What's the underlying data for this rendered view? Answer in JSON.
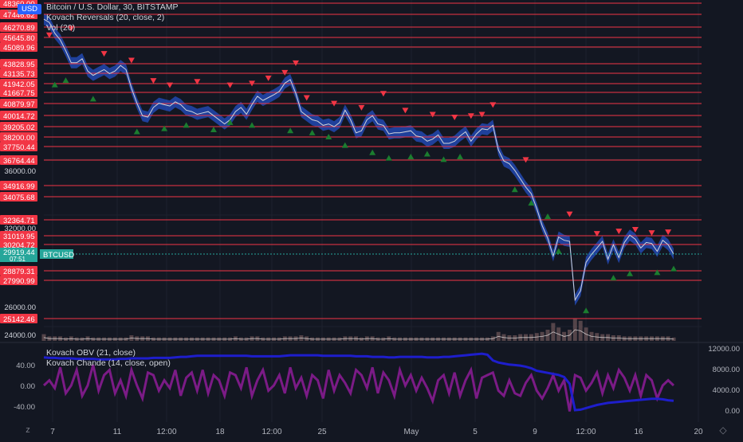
{
  "legend": {
    "symbol": "Bitcoin / U.S. Dollar, 30, BITSTAMP",
    "ind1": "Kovach Reversals (20, close, 2)",
    "ind2": "Vol (20)",
    "osc1": "Kovach OBV (21, close)",
    "osc2": "Kovach Chande (14, close, open)"
  },
  "currency_badge": "USD",
  "icons": {
    "top_left": "chevron-down-icon",
    "bottom_left": "z-zoom-icon",
    "bottom_right": "diamond-icon"
  },
  "colors": {
    "background": "#131722",
    "level_line": "#f23645",
    "level_label_bg": "#f23645",
    "price_line": "#d1d4dc",
    "band": "#2962ff",
    "sell_marker": "#f23645",
    "buy_marker": "#1b7d2f",
    "current_price": "#26a69a",
    "obv": "#1e1ecc",
    "chande": "#7b1b86"
  },
  "chart_data": {
    "type": "line",
    "title": "Bitcoin / U.S. Dollar, 30, BITSTAMP",
    "price_axis": {
      "ticks": [
        {
          "value": 36000,
          "label": "36000.00"
        },
        {
          "value": 32000,
          "label": "32000.00"
        },
        {
          "value": 26000,
          "label": "26000.00"
        },
        {
          "value": 24000,
          "label": "24000.00"
        }
      ]
    },
    "levels": [
      {
        "value": 48360.0,
        "label": "48360.00"
      },
      {
        "value": 47446.62,
        "label": "47446.62"
      },
      {
        "value": 46270.89,
        "label": "46270.89"
      },
      {
        "value": 45645.8,
        "label": "45645.80"
      },
      {
        "value": 45089.96,
        "label": "45089.96"
      },
      {
        "value": 43828.95,
        "label": "43828.95"
      },
      {
        "value": 43135.73,
        "label": "43135.73"
      },
      {
        "value": 41942.05,
        "label": "41942.05"
      },
      {
        "value": 41667.75,
        "label": "41667.75"
      },
      {
        "value": 40879.97,
        "label": "40879.97"
      },
      {
        "value": 40014.72,
        "label": "40014.72"
      },
      {
        "value": 39205.02,
        "label": "39205.02"
      },
      {
        "value": 38200.0,
        "label": "38200.00"
      },
      {
        "value": 37750.44,
        "label": "37750.44"
      },
      {
        "value": 36764.44,
        "label": "36764.44"
      },
      {
        "value": 34916.99,
        "label": "34916.99"
      },
      {
        "value": 34075.68,
        "label": "34075.68"
      },
      {
        "value": 32364.71,
        "label": "32364.71"
      },
      {
        "value": 31019.95,
        "label": "31019.95"
      },
      {
        "value": 30204.72,
        "label": "30204.72"
      },
      {
        "value": 28879.31,
        "label": "28879.31"
      },
      {
        "value": 27990.99,
        "label": "27990.99"
      },
      {
        "value": 25142.46,
        "label": "25142.46"
      }
    ],
    "current_price": {
      "value": 29919.44,
      "label": "29919.44",
      "countdown": "07:51",
      "symbol_tag": "BTCUSD"
    },
    "x_ticks": [
      "7",
      "11",
      "12:00",
      "18",
      "12:00",
      "25",
      "May",
      "5",
      "9",
      "12:00",
      "16",
      "20"
    ],
    "price_series": {
      "name": "BTCUSD close",
      "values": [
        47000,
        46700,
        45900,
        45500,
        44800,
        43900,
        43900,
        44200,
        43300,
        42900,
        43200,
        43400,
        43100,
        43300,
        43700,
        43400,
        41800,
        40900,
        40000,
        39900,
        40600,
        40900,
        40800,
        40700,
        41000,
        40800,
        40400,
        40300,
        40100,
        40200,
        40300,
        40000,
        39700,
        39400,
        39700,
        40300,
        40600,
        40100,
        40800,
        41400,
        41100,
        41300,
        41500,
        41700,
        42000,
        42400,
        41600,
        40300,
        40000,
        39700,
        39600,
        39300,
        39400,
        39200,
        39500,
        40400,
        39700,
        38600,
        38800,
        39700,
        40000,
        39400,
        39300,
        38500,
        38600,
        38600,
        38700,
        38800,
        38300,
        38200,
        38000,
        38100,
        38400,
        37900,
        37900,
        38000,
        38300,
        38700,
        38000,
        38500,
        39000,
        38900,
        39300,
        37500,
        36700,
        36500,
        36000,
        35400,
        34800,
        34300,
        33200,
        32100,
        30800,
        29800,
        30900,
        30600,
        30500,
        26500,
        27200,
        29400,
        29900,
        30100,
        30500,
        29600,
        30200,
        29700,
        30400,
        31100,
        30700,
        30100,
        30400,
        30300,
        30000,
        30600,
        30200,
        29919
      ]
    },
    "sell_signals": [
      {
        "i": 1,
        "y": 45800
      },
      {
        "i": 5,
        "y": 46200
      },
      {
        "i": 11,
        "y": 44600
      },
      {
        "i": 16,
        "y": 44100
      },
      {
        "i": 20,
        "y": 42300
      },
      {
        "i": 23,
        "y": 41900
      },
      {
        "i": 28,
        "y": 42200
      },
      {
        "i": 34,
        "y": 41900
      },
      {
        "i": 38,
        "y": 42000
      },
      {
        "i": 41,
        "y": 42600
      },
      {
        "i": 44,
        "y": 43200
      },
      {
        "i": 46,
        "y": 43900
      },
      {
        "i": 48,
        "y": 41300
      },
      {
        "i": 53,
        "y": 40900
      },
      {
        "i": 58,
        "y": 40600
      },
      {
        "i": 62,
        "y": 41600
      },
      {
        "i": 66,
        "y": 40400
      },
      {
        "i": 71,
        "y": 40100
      },
      {
        "i": 75,
        "y": 39900
      },
      {
        "i": 78,
        "y": 40000
      },
      {
        "i": 80,
        "y": 40100
      },
      {
        "i": 82,
        "y": 40800
      },
      {
        "i": 88,
        "y": 36800
      },
      {
        "i": 96,
        "y": 32800
      },
      {
        "i": 101,
        "y": 31300
      },
      {
        "i": 105,
        "y": 31600
      },
      {
        "i": 108,
        "y": 31800
      },
      {
        "i": 111,
        "y": 31400
      },
      {
        "i": 114,
        "y": 31500
      }
    ],
    "buy_signals": [
      {
        "i": 2,
        "y": 41900
      },
      {
        "i": 4,
        "y": 42300
      },
      {
        "i": 9,
        "y": 41200
      },
      {
        "i": 17,
        "y": 38700
      },
      {
        "i": 22,
        "y": 39000
      },
      {
        "i": 26,
        "y": 39300
      },
      {
        "i": 31,
        "y": 38900
      },
      {
        "i": 34,
        "y": 39500
      },
      {
        "i": 38,
        "y": 39300
      },
      {
        "i": 45,
        "y": 38800
      },
      {
        "i": 49,
        "y": 38600
      },
      {
        "i": 52,
        "y": 38200
      },
      {
        "i": 55,
        "y": 37800
      },
      {
        "i": 60,
        "y": 37300
      },
      {
        "i": 63,
        "y": 36900
      },
      {
        "i": 67,
        "y": 37000
      },
      {
        "i": 70,
        "y": 37200
      },
      {
        "i": 73,
        "y": 36800
      },
      {
        "i": 76,
        "y": 37000
      },
      {
        "i": 86,
        "y": 34600
      },
      {
        "i": 89,
        "y": 33600
      },
      {
        "i": 92,
        "y": 32600
      },
      {
        "i": 94,
        "y": 30000
      },
      {
        "i": 99,
        "y": 25700
      },
      {
        "i": 104,
        "y": 28200
      },
      {
        "i": 107,
        "y": 28600
      },
      {
        "i": 112,
        "y": 28700
      },
      {
        "i": 115,
        "y": 29000
      }
    ],
    "volume": {
      "name": "Vol",
      "values": [
        0.3,
        0.2,
        0.2,
        0.2,
        0.15,
        0.2,
        0.15,
        0.15,
        0.2,
        0.15,
        0.15,
        0.15,
        0.15,
        0.15,
        0.15,
        0.15,
        0.25,
        0.2,
        0.2,
        0.2,
        0.15,
        0.15,
        0.15,
        0.15,
        0.15,
        0.15,
        0.15,
        0.15,
        0.15,
        0.15,
        0.15,
        0.15,
        0.15,
        0.15,
        0.15,
        0.2,
        0.15,
        0.15,
        0.2,
        0.2,
        0.15,
        0.15,
        0.15,
        0.15,
        0.2,
        0.2,
        0.2,
        0.25,
        0.2,
        0.15,
        0.15,
        0.15,
        0.15,
        0.15,
        0.15,
        0.2,
        0.2,
        0.2,
        0.15,
        0.2,
        0.2,
        0.15,
        0.15,
        0.2,
        0.15,
        0.15,
        0.15,
        0.15,
        0.15,
        0.15,
        0.15,
        0.15,
        0.15,
        0.15,
        0.15,
        0.15,
        0.15,
        0.15,
        0.15,
        0.15,
        0.15,
        0.15,
        0.2,
        0.4,
        0.3,
        0.25,
        0.25,
        0.3,
        0.3,
        0.3,
        0.35,
        0.4,
        0.5,
        0.8,
        0.6,
        0.4,
        0.5,
        1.0,
        0.9,
        0.6,
        0.4,
        0.35,
        0.3,
        0.3,
        0.25,
        0.25,
        0.2,
        0.2,
        0.2,
        0.2,
        0.2,
        0.2,
        0.2,
        0.2,
        0.2,
        0.15
      ]
    },
    "obv": {
      "axis_ticks": [
        {
          "value": 12000,
          "label": "12000.00"
        },
        {
          "value": 8000,
          "label": "8000.00"
        },
        {
          "value": 4000,
          "label": "4000.00"
        },
        {
          "value": 0,
          "label": "0.00"
        }
      ],
      "values": [
        10200,
        10100,
        10100,
        10000,
        10000,
        10000,
        9900,
        9900,
        9900,
        9900,
        9800,
        9800,
        9800,
        9800,
        9900,
        9900,
        10000,
        10000,
        10000,
        10000,
        10100,
        10100,
        10100,
        10100,
        10200,
        10300,
        10300,
        10400,
        10500,
        10500,
        10500,
        10500,
        10500,
        10500,
        10500,
        10500,
        10500,
        10500,
        10400,
        10400,
        10400,
        10400,
        10400,
        10400,
        10500,
        10600,
        10600,
        10600,
        10600,
        10600,
        10600,
        10500,
        10500,
        10500,
        10500,
        10500,
        10500,
        10400,
        10400,
        10400,
        10300,
        10300,
        10300,
        10200,
        10200,
        10300,
        10300,
        10300,
        10300,
        10300,
        10200,
        10200,
        10200,
        10300,
        10300,
        10400,
        10500,
        10600,
        10700,
        10800,
        10900,
        10700,
        9600,
        9200,
        9000,
        8800,
        8700,
        8600,
        8400,
        8100,
        7600,
        7400,
        7200,
        7000,
        6800,
        6400,
        5100,
        0,
        100,
        400,
        700,
        1000,
        1200,
        1400,
        1500,
        1600,
        1700,
        1800,
        1900,
        2000,
        2100,
        2200,
        2200,
        2100,
        1900,
        1800
      ]
    },
    "chande": {
      "axis_ticks": [
        {
          "value": 40,
          "label": "40.00"
        },
        {
          "value": 0,
          "label": "0.00"
        },
        {
          "value": -40,
          "label": "-40.00"
        }
      ],
      "values": [
        0,
        10,
        -5,
        35,
        -15,
        0,
        30,
        -20,
        0,
        40,
        -10,
        20,
        30,
        -15,
        10,
        -20,
        30,
        0,
        -25,
        25,
        20,
        -10,
        10,
        -5,
        30,
        -20,
        15,
        25,
        -10,
        30,
        -15,
        20,
        10,
        -20,
        25,
        20,
        -5,
        35,
        -20,
        10,
        30,
        -10,
        0,
        20,
        -15,
        35,
        -5,
        15,
        -20,
        20,
        10,
        -25,
        30,
        -10,
        20,
        5,
        -15,
        30,
        20,
        -5,
        35,
        -15,
        25,
        10,
        -20,
        30,
        0,
        20,
        -10,
        15,
        -5,
        -30,
        10,
        20,
        -15,
        25,
        -20,
        10,
        30,
        -25,
        15,
        20,
        25,
        -10,
        -20,
        10,
        -15,
        -20,
        5,
        20,
        -10,
        -25,
        -5,
        20,
        -10,
        10,
        -50,
        20,
        15,
        -10,
        5,
        25,
        -15,
        20,
        -5,
        30,
        15,
        -10,
        20,
        -20,
        20,
        10,
        -25,
        0,
        10,
        0
      ]
    }
  }
}
